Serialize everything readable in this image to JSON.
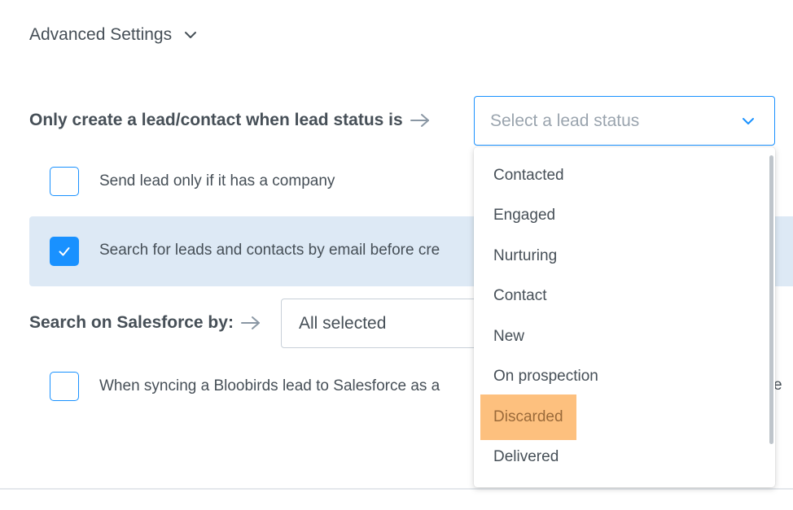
{
  "advanced_settings": {
    "label": "Advanced Settings"
  },
  "lead_status": {
    "label": "Only create a lead/contact when lead status is",
    "placeholder": "Select a lead status",
    "options": [
      "Contacted",
      "Engaged",
      "Nurturing",
      "Contact",
      "New",
      "On prospection",
      "Discarded",
      "Delivered"
    ],
    "highlighted_option": "Discarded"
  },
  "checkboxes": {
    "company": {
      "label": "Send lead only if it has a company",
      "checked": false
    },
    "email": {
      "label": "Search for leads and contacts by email before cre",
      "checked": true
    },
    "syncing": {
      "label": "When syncing a Bloobirds lead to Salesforce as a",
      "checked": false,
      "trailing_text": "e"
    }
  },
  "salesforce_search": {
    "label": "Search on Salesforce by:",
    "value": "All selected"
  },
  "colors": {
    "accent": "#1991ff",
    "highlight": "#fdc07e",
    "selected_row_bg": "#dde9f5",
    "text": "#464f57"
  }
}
